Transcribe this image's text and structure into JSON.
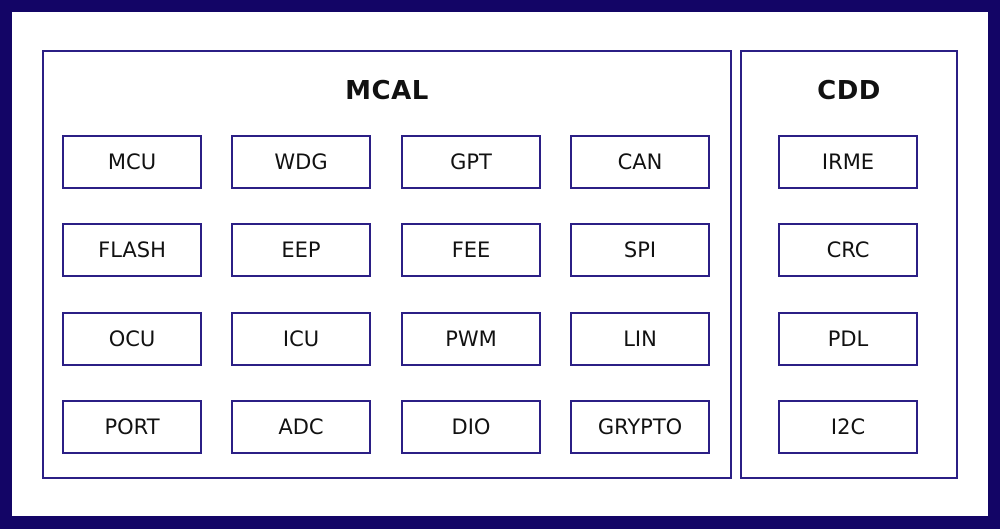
{
  "colors": {
    "frame": "#130566",
    "border": "#2b1f85",
    "text": "#111111"
  },
  "panels": [
    {
      "title": "MCAL",
      "modules": [
        "MCU",
        "WDG",
        "GPT",
        "CAN",
        "FLASH",
        "EEP",
        "FEE",
        "SPI",
        "OCU",
        "ICU",
        "PWM",
        "LIN",
        "PORT",
        "ADC",
        "DIO",
        "GRYPTO"
      ]
    },
    {
      "title": "CDD",
      "modules": [
        "IRME",
        "CRC",
        "PDL",
        "I2C"
      ]
    }
  ]
}
